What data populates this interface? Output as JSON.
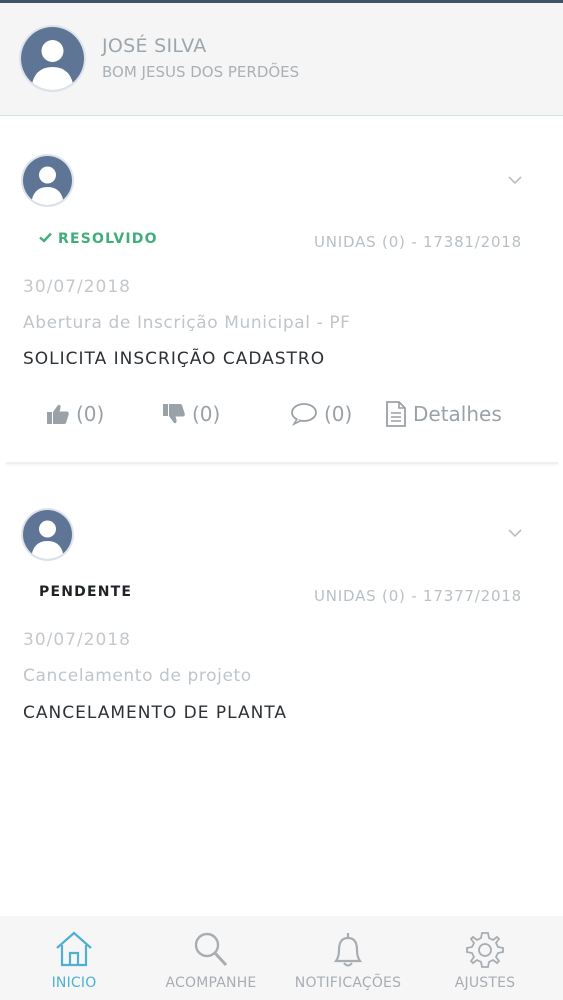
{
  "user": {
    "name": "JOSÉ SILVA",
    "city": "BOM JESUS DOS PERDÕES"
  },
  "cards": [
    {
      "status": "RESOLVIDO",
      "status_color": "#3fae7a",
      "units": "UNIDAS (0) - 17381/2018",
      "date": "30/07/2018",
      "service": "Abertura de Inscrição Municipal - PF",
      "subject": "SOLICITA INSCRIÇÃO CADASTRO",
      "likes": "(0)",
      "dislikes": "(0)",
      "comments": "(0)",
      "details_label": "Detalhes"
    },
    {
      "status": "PENDENTE",
      "units": "UNIDAS (0) - 17377/2018",
      "date": "30/07/2018",
      "service": "Cancelamento de projeto",
      "subject": "CANCELAMENTO DE PLANTA"
    }
  ],
  "tabs": [
    {
      "label": "INICIO",
      "icon": "home-icon",
      "active": true
    },
    {
      "label": "ACOMPANHE",
      "icon": "search-icon"
    },
    {
      "label": "NOTIFICAÇÕES",
      "icon": "bell-icon"
    },
    {
      "label": "AJUSTES",
      "icon": "gear-icon"
    }
  ],
  "colors": {
    "accent": "#4fb0cf",
    "resolved": "#3fae7a",
    "header_bg": "#f5f5f5"
  }
}
